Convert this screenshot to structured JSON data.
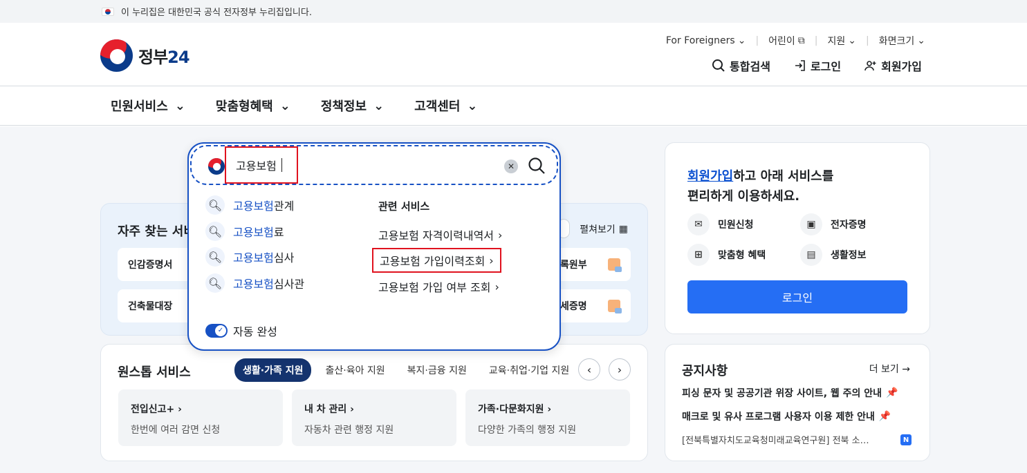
{
  "gov_banner": {
    "text": "이 누리집은 대한민국 공식 전자정부 누리집입니다."
  },
  "logo": {
    "text_main": "정부",
    "text_num": "24"
  },
  "util_menu": [
    {
      "label": "For Foreigners",
      "icon": "chevron-down-icon"
    },
    {
      "label": "어린이",
      "icon": "external-link-icon"
    },
    {
      "label": "지원",
      "icon": "chevron-down-icon"
    },
    {
      "label": "화면크기",
      "icon": "chevron-down-icon"
    }
  ],
  "header_actions": {
    "search": "통합검색",
    "login": "로그인",
    "signup": "회원가입"
  },
  "gnb": [
    "민원서비스",
    "맞춤형혜택",
    "정책정보",
    "고객센터"
  ],
  "freq": {
    "title": "자주 찾는 서비",
    "expand": "펼쳐보기",
    "cards": [
      "인감증명서",
      "건축물대장",
      "록원부",
      "세증명"
    ]
  },
  "onestop": {
    "title": "원스톱 서비스",
    "chips": [
      "생활·가족 지원",
      "출산·육아 지원",
      "복지·금융 지원",
      "교육·취업·기업 지원"
    ],
    "cards": [
      {
        "title": "전입신고+",
        "desc": "한번에 여러 감면 신청"
      },
      {
        "title": "내 차 관리",
        "desc": "자동차 관련 행정 지원"
      },
      {
        "title": "가족·다문화지원",
        "desc": "다양한 가족의 행정 지원"
      }
    ]
  },
  "member": {
    "link": "회원가입",
    "line1_rest": "하고 아래 서비스를",
    "line2": "편리하게 이용하세요.",
    "items": [
      "민원신청",
      "전자증명",
      "맞춤형 혜택",
      "생활정보"
    ],
    "login_button": "로그인"
  },
  "notice": {
    "title": "공지사항",
    "more": "더 보기",
    "items": [
      "피싱 문자 및 공공기관 위장 사이트, 웹 주의 안내",
      "매크로 및 유사 프로그램 사용자 이용 제한 안내",
      "[전북특별자치도교육청미래교육연구원] 전북 소…"
    ],
    "badge": "N"
  },
  "search": {
    "value": "고용보험",
    "suggestions": [
      {
        "hl": "고용보험",
        "rest": "관계"
      },
      {
        "hl": "고용보험",
        "rest": "료"
      },
      {
        "hl": "고용보험",
        "rest": "심사"
      },
      {
        "hl": "고용보험",
        "rest": "심사관"
      }
    ],
    "related_title": "관련 서비스",
    "related": [
      "고용보험 자격이력내역서",
      "고용보험 가입이력조회",
      "고용보험 가입 여부 조회"
    ],
    "autocomplete_label": "자동 완성",
    "autocomplete_on": true
  },
  "colors": {
    "accent": "#1751c4",
    "primary_button": "#256ef4",
    "highlight_box": "#e0121e",
    "chip_active": "#14336e"
  }
}
